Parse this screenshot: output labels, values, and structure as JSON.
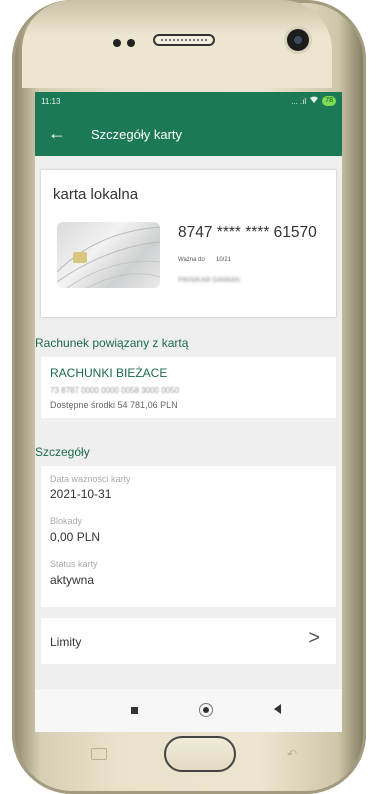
{
  "status": {
    "time": "11:13",
    "icons_text": "... .ıl",
    "battery": "78"
  },
  "appbar": {
    "back_icon": "arrow-left-icon",
    "title": "Szczegóły karty"
  },
  "card": {
    "label": "karta lokalna",
    "number": "8747 **** **** 61570",
    "valid_label": "Ważna do",
    "valid_value": "10/21",
    "holder": "PIKNIKAR DAMIAN"
  },
  "linked_account": {
    "heading": "Rachunek powiązany z kartą",
    "name": "RACHUNKI BIEŻACE",
    "iban": "73 8787 0000 0000 0058 3000 0050",
    "available": "Dostępne środki 54 781,06 PLN"
  },
  "details": {
    "heading": "Szczegóły",
    "expiry_label": "Data ważności karty",
    "expiry_value": "2021-10-31",
    "blocks_label": "Blokady",
    "blocks_value": "0,00 PLN",
    "status_label": "Status karty",
    "status_value": "aktywna"
  },
  "limits": {
    "label": "Limity",
    "chevron": ">"
  },
  "colors": {
    "primary": "#1b7a55",
    "accent_text": "#1b6b4a",
    "screen_bg": "#efefef"
  }
}
